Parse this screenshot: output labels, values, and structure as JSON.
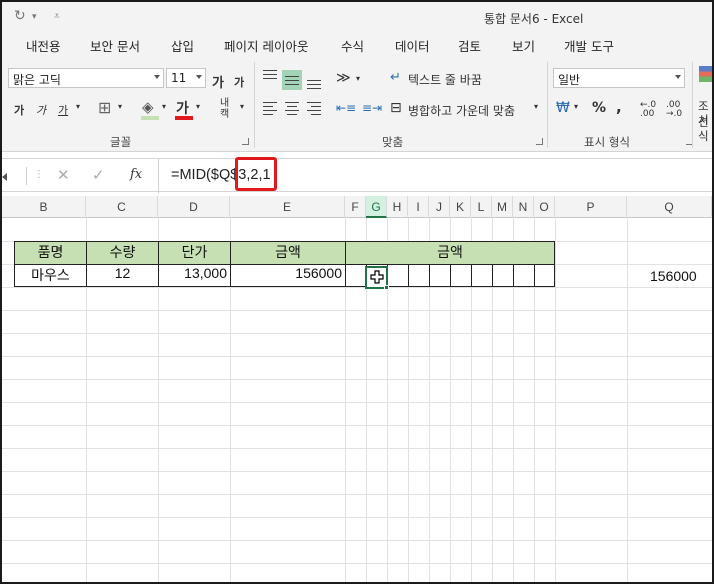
{
  "window": {
    "title": "통합 문서6 - Excel"
  },
  "ribbon_tabs": [
    "내전용",
    "보안 문서",
    "삽입",
    "페이지 레이아웃",
    "수식",
    "데이터",
    "검토",
    "보기",
    "개발 도구"
  ],
  "font": {
    "name": "맑은 고딕",
    "size": "11"
  },
  "ribbon": {
    "wrap_text": "텍스트 줄 바꿈",
    "merge_center": "병합하고 가운데 맞춤",
    "number_format": "일반",
    "groups": {
      "font": "글꼴",
      "alignment": "맞춤",
      "number": "표시 형식"
    },
    "cut_off_right": [
      "조건",
      "서식"
    ]
  },
  "formula_bar": {
    "formula": "=MID($Q$3,2,1",
    "fx": "fx"
  },
  "columns": [
    "B",
    "C",
    "D",
    "E",
    "F",
    "G",
    "H",
    "I",
    "J",
    "K",
    "L",
    "M",
    "N",
    "O",
    "P",
    "Q"
  ],
  "active_column": "G",
  "table": {
    "headers": {
      "product": "품명",
      "qty": "수량",
      "unit_price": "단가",
      "amount": "금액",
      "amount_digits": "금액"
    },
    "row": {
      "product": "마우스",
      "qty": "12",
      "unit_price": "13,000",
      "amount": "156000"
    }
  },
  "q_cell_value": "156000",
  "colors": {
    "header_fill": "#c6e0b4",
    "selection": "#217346",
    "highlight": "#e0191f"
  }
}
